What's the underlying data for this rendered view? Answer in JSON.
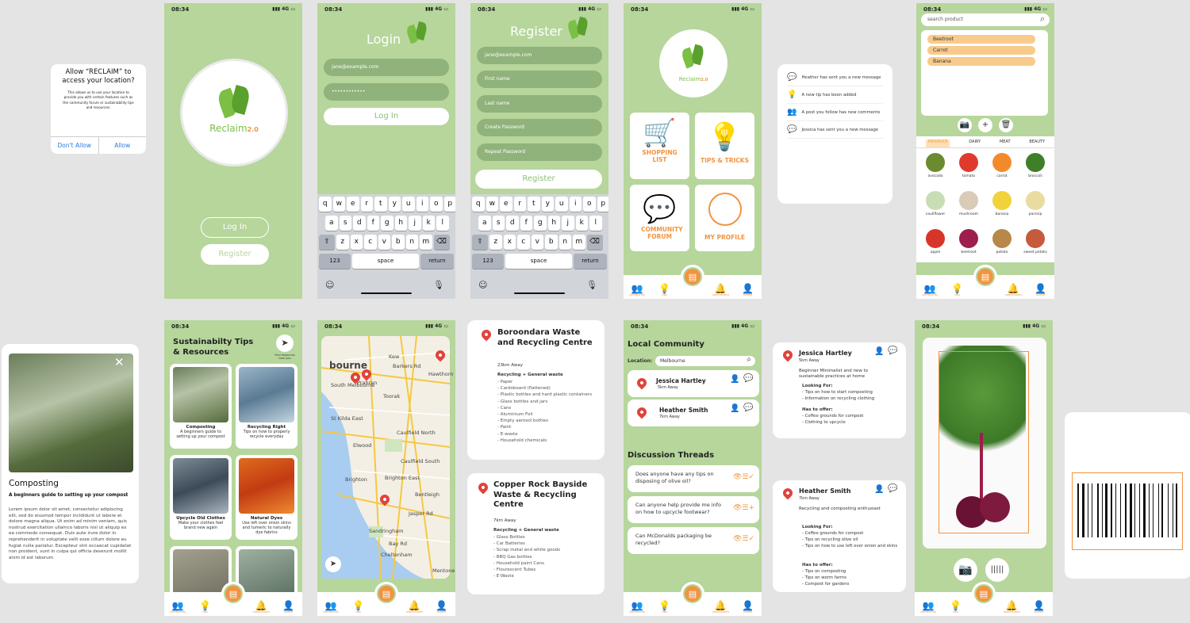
{
  "status": {
    "time": "08:34",
    "signal": "4G"
  },
  "alert": {
    "title": "Allow “RECLAIM” to access your location?",
    "body": "This allows us to use your location to provide you with certain features such as the community forum or sustainability tips and resources.",
    "deny": "Don't Allow",
    "allow": "Allow"
  },
  "splash": {
    "logo_text": "Reclaim",
    "logo_ver": "2.0",
    "login": "Log In",
    "register": "Register"
  },
  "login": {
    "title": "Login",
    "email": "jane@example.com",
    "password": "••••••••••••",
    "button": "Log In"
  },
  "register": {
    "title": "Register",
    "fields": [
      "jane@example.com",
      "First name",
      "Last name",
      "Create Password",
      "Repeat Password"
    ],
    "button": "Register"
  },
  "keyboard": {
    "row1": [
      "q",
      "w",
      "e",
      "r",
      "t",
      "y",
      "u",
      "i",
      "o",
      "p"
    ],
    "row2": [
      "a",
      "s",
      "d",
      "f",
      "g",
      "h",
      "j",
      "k",
      "l"
    ],
    "row3": [
      "z",
      "x",
      "c",
      "v",
      "b",
      "n",
      "m"
    ],
    "num": "123",
    "space": "space",
    "ret": "return"
  },
  "home": {
    "cards": [
      "SHOPPING LIST",
      "TIPS & TRICKS",
      "COMMUNITY FORUM",
      "MY PROFILE"
    ]
  },
  "nav": {
    "items": [
      "community",
      "tips",
      "",
      "notifications",
      "profile"
    ]
  },
  "notifications": [
    "Heather has sent you a new message",
    "A new tip has been added",
    "A post you follow has new comments",
    "Jessica has sent you a new message"
  ],
  "shopping": {
    "search_placeholder": "search product",
    "list": [
      "Beetroot",
      "Carrot",
      "Banana"
    ],
    "tabs": [
      "PRODUCE",
      "DAIRY",
      "MEAT",
      "BEAUTY"
    ],
    "produce": [
      "avocado",
      "tomato",
      "carrot",
      "broccoli",
      "cauliflower",
      "mushroom",
      "banana",
      "parsnip",
      "apple",
      "beetroot",
      "potato",
      "sweet potato"
    ]
  },
  "compost": {
    "title": "Composting",
    "subtitle": "A beginners guide to setting up your compost",
    "body": "Lorem ipsum dolor sit amet, consectetur adipiscing elit, sed do eiusmod tempor incididunt ut labore et dolore magna aliqua. Ut enim ad minim veniam, quis nostrud exercitation ullamco laboris nisi ut aliquip ex ea commodo consequat. Duis aute irure dolor in reprehenderit in voluptate velit esse cillum dolore eu fugiat nulla pariatur. Excepteur sint occaecat cupidatat non proident, sunt in culpa qui officia deserunt mollit anim id est laborum"
  },
  "tips": {
    "title": "Sustainabilty Tips & Resources",
    "find": "Find resources near you",
    "items": [
      {
        "t": "Composting",
        "d": "A beginners guide to setting up your compost"
      },
      {
        "t": "Recycling Right",
        "d": "Tips on how to properly recycle everyday"
      },
      {
        "t": "Upcycle Old Clothes",
        "d": "Make your clothes feel brand new again"
      },
      {
        "t": "Natural Dyes",
        "d": "Use left over onion skins and tumeric to naturally dye fabrics"
      }
    ]
  },
  "map": {
    "labels": [
      "Kew",
      "bourne",
      "Barkers Rd",
      "Hawthorn",
      "South Melbourne",
      "Prahran",
      "Toorak",
      "St Kilda East",
      "Caulfield North",
      "Elwood",
      "Caulfield South",
      "Brighton",
      "Brighton East",
      "Bentleigh",
      "Sandringham",
      "Cheltenham",
      "Mentone",
      "Bay Rd",
      "Jasper Rd"
    ]
  },
  "centres": [
    {
      "name": "Boroondara Waste and Recycling Centre",
      "dist": "23km Away",
      "head": "Recycling + General waste",
      "items": [
        "- Paper",
        "- Cardoboard (flattened)",
        "- Plastic bottles and hard plastic containers",
        "- Glass bottles and jars",
        "- Cans",
        "- Aluminium Foil",
        "- Empty aerosol bottles",
        "- Paint",
        "- E-waste",
        "- Household chemicals"
      ]
    },
    {
      "name": "Copper Rock Bayside Waste & Recycling Centre",
      "dist": "7km Away",
      "head": "Recycling + General waste",
      "items": [
        "- Glass Bottles",
        "- Car Batteries",
        "- Scrap metal and white goods",
        "- BBQ Gas bottles",
        "- Household paint Cans",
        "- Flourescent Tubes",
        "- E-Waste"
      ]
    }
  ],
  "community": {
    "title": "Local Community",
    "loc_label": "Location:",
    "loc": "Melbourne",
    "people": [
      {
        "n": "Jessica Hartley",
        "d": "5km Away"
      },
      {
        "n": "Heather Smith",
        "d": "7km Away"
      }
    ],
    "threads_title": "Discussion Threads",
    "threads": [
      "Does anyone have any tips on disposing of olive oil?",
      "Can anyone help provide me info on how to upcycle footwear?",
      "Can McDonalds packaging be recycled?"
    ],
    "profile": "profile",
    "chat": "chat"
  },
  "profiles": [
    {
      "n": "Jessica Hartley",
      "d": "5km Away",
      "bio": "Beginner Minimalist and new to sustainable practices at home",
      "lf": "Looking For:",
      "lfi": [
        "- Tips on how to start composting",
        "- Information on recycling clothing"
      ],
      "ho": "Has to offer:",
      "hoi": [
        "- Coffee grounds for compost",
        "- Clothing to upcycle"
      ]
    },
    {
      "n": "Heather Smith",
      "d": "7km Away",
      "bio": "Recycling and composting enthusiast",
      "lf": "Looking For:",
      "lfi": [
        "- Coffee grounds for compost",
        "- Tips on recycling olive oil",
        "- Tips on how to use left over onion and skins"
      ],
      "ho": "Has to offer:",
      "hoi": [
        "- Tips on composting",
        "- Tips on worm farms",
        "- Compost for gardens"
      ]
    }
  ],
  "colors": {
    "green": "#b6d69c",
    "orange": "#f1943f",
    "dark_green": "#8fb37a"
  }
}
